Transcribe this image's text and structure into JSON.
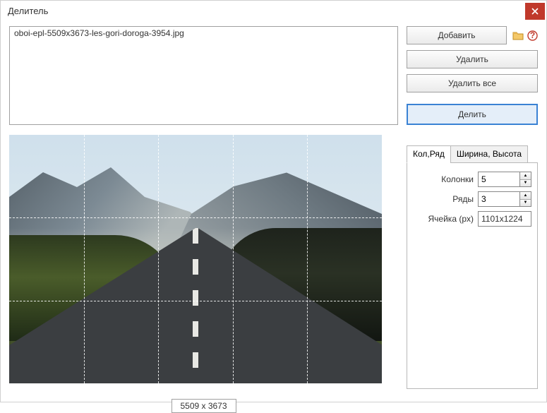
{
  "window": {
    "title": "Делитель"
  },
  "file_list": {
    "items": [
      "oboi-epl-5509x3673-les-gori-doroga-3954.jpg"
    ]
  },
  "buttons": {
    "add": "Добавить",
    "remove": "Удалить",
    "remove_all": "Удалить все",
    "split": "Делить"
  },
  "tabs": {
    "colrow": "Кол,Ряд",
    "wh": "Ширина, Высота"
  },
  "form": {
    "columns_label": "Колонки",
    "columns_value": "5",
    "rows_label": "Ряды",
    "rows_value": "3",
    "cell_label": "Ячейка (px)",
    "cell_value": "1101x1224"
  },
  "preview": {
    "dimensions": "5509 x 3673",
    "cols": 5,
    "rows": 3
  }
}
